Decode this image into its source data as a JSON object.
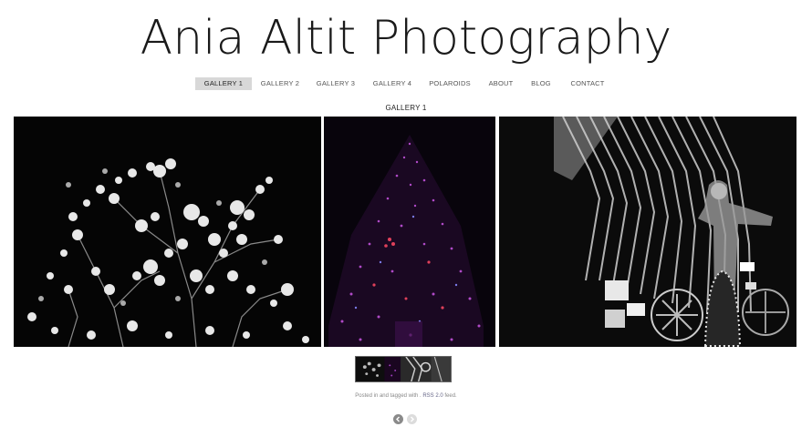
{
  "header": {
    "title": "Ania Altit Photography"
  },
  "nav": {
    "items": [
      {
        "label": "GALLERY 1",
        "active": true
      },
      {
        "label": "GALLERY 2",
        "active": false
      },
      {
        "label": "GALLERY 3",
        "active": false
      },
      {
        "label": "GALLERY 4",
        "active": false
      },
      {
        "label": "POLAROIDS",
        "active": false
      },
      {
        "label": "ABOUT",
        "active": false
      },
      {
        "label": "BLOG",
        "active": false
      },
      {
        "label": "CONTACT",
        "active": false
      }
    ]
  },
  "gallery": {
    "heading": "GALLERY 1",
    "photos": [
      {
        "subject": "black-and-white blossoms at night"
      },
      {
        "subject": "tree with purple and red lights"
      },
      {
        "subject": "black-and-white light projection"
      }
    ]
  },
  "post_meta": {
    "prefix": "Posted in and tagged with . ",
    "rss_label": "RSS 2.0",
    "suffix": " feed."
  },
  "pager": {
    "prev_icon": "chevron-left-icon",
    "next_icon": "chevron-right-icon"
  }
}
